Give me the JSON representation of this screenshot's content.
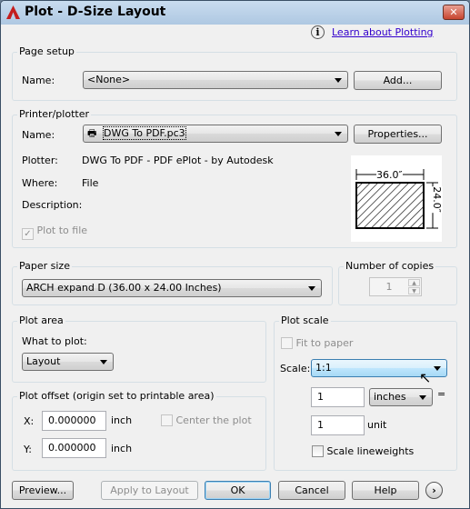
{
  "window": {
    "title": "Plot - D-Size Layout",
    "close_icon": "close-icon"
  },
  "help_link": "Learn about Plotting",
  "page_setup": {
    "label": "Page setup",
    "name_label": "Name:",
    "name_value": "<None>",
    "add_button": "Add..."
  },
  "printer": {
    "label": "Printer/plotter",
    "name_label": "Name:",
    "name_value": "DWG To PDF.pc3",
    "properties_button": "Properties...",
    "plotter_label": "Plotter:",
    "plotter_value": "DWG To PDF - PDF ePlot - by Autodesk",
    "where_label": "Where:",
    "where_value": "File",
    "description_label": "Description:",
    "plot_to_file": "Plot to file",
    "plot_to_file_checked": true,
    "preview_width": "36.0″",
    "preview_height": "24.0″"
  },
  "paper_size": {
    "label": "Paper size",
    "value": "ARCH expand D (36.00 x 24.00 Inches)"
  },
  "copies": {
    "label": "Number of copies",
    "value": "1"
  },
  "plot_area": {
    "label": "Plot area",
    "what_label": "What to plot:",
    "what_value": "Layout"
  },
  "plot_offset": {
    "label": "Plot offset (origin set to printable area)",
    "x_label": "X:",
    "x_value": "0.000000",
    "x_unit": "inch",
    "y_label": "Y:",
    "y_value": "0.000000",
    "y_unit": "inch",
    "center_label": "Center the plot",
    "center_checked": false
  },
  "plot_scale": {
    "label": "Plot scale",
    "fit_label": "Fit to paper",
    "fit_checked": false,
    "scale_label": "Scale:",
    "scale_value": "1:1",
    "units_value": "1",
    "units_type": "inches",
    "equals": "=",
    "drawing_value": "1",
    "drawing_unit": "unit",
    "lineweights_label": "Scale lineweights",
    "lineweights_checked": false
  },
  "buttons": {
    "preview": "Preview...",
    "apply": "Apply to Layout",
    "ok": "OK",
    "cancel": "Cancel",
    "help": "Help"
  }
}
